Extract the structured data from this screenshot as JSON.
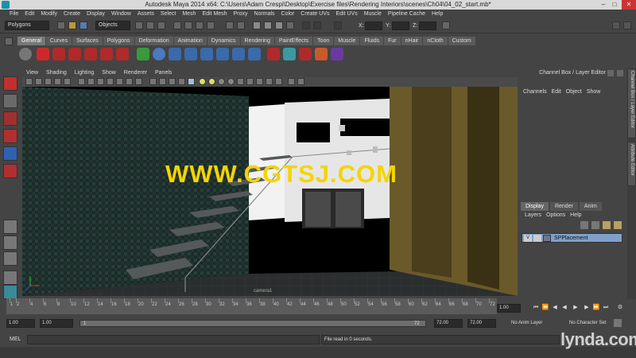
{
  "window": {
    "title": "Autodesk Maya 2014 x64: C:\\Users\\Adam Crespi\\Desktop\\Exercise files\\Rendering Interiors\\scenes\\Ch04\\04_02_start.mb*",
    "minimize": "–",
    "maximize": "□",
    "close": "✕"
  },
  "menubar": [
    "File",
    "Edit",
    "Modify",
    "Create",
    "Display",
    "Window",
    "Assets",
    "Select",
    "Mesh",
    "Edit Mesh",
    "Proxy",
    "Normals",
    "Color",
    "Create UVs",
    "Edit UVs",
    "Muscle",
    "Pipeline Cache",
    "Help"
  ],
  "statusline": {
    "mode": "Polygons",
    "selection_mode": "Objects",
    "x_label": "X:",
    "y_label": "Y:",
    "z_label": "Z:"
  },
  "shelf": {
    "tabs": [
      "General",
      "Curves",
      "Surfaces",
      "Polygons",
      "Deformation",
      "Animation",
      "Dynamics",
      "Rendering",
      "PaintEffects",
      "Toon",
      "Muscle",
      "Fluids",
      "Fur",
      "nHair",
      "nCloth",
      "Custom"
    ],
    "active": "General"
  },
  "viewport": {
    "menu": [
      "View",
      "Shading",
      "Lighting",
      "Show",
      "Renderer",
      "Panels"
    ],
    "camera": "camera1",
    "watermark": "WWW.CGTSJ.COM"
  },
  "channelbox": {
    "title": "Channel Box / Layer Editor",
    "menu": [
      "Channels",
      "Edit",
      "Object",
      "Show"
    ],
    "side_tabs": [
      "Channel Box / Layer Editor",
      "Attribute Editor"
    ]
  },
  "layer_editor": {
    "tabs": [
      "Display",
      "Render",
      "Anim"
    ],
    "active": "Display",
    "menu": [
      "Layers",
      "Options",
      "Help"
    ],
    "layers": [
      {
        "visible": "V",
        "name": "SPPlacement"
      }
    ]
  },
  "timeslider": {
    "ticks": [
      "1",
      "2",
      "4",
      "6",
      "8",
      "10",
      "12",
      "14",
      "16",
      "18",
      "20",
      "22",
      "24",
      "26",
      "28",
      "30",
      "32",
      "34",
      "36",
      "38",
      "40",
      "42",
      "44",
      "46",
      "48",
      "50",
      "52",
      "54",
      "56",
      "58",
      "60",
      "62",
      "64",
      "66",
      "68",
      "70",
      "72"
    ],
    "current_time": "1.00"
  },
  "rangeslider": {
    "start": "1.00",
    "anim_start": "1.00",
    "range_start": "1",
    "range_end": "72",
    "anim_end": "72.00",
    "end": "72.00",
    "anim_layer": "No Anim Layer",
    "character_set": "No Character Set"
  },
  "commandline": {
    "label": "MEL",
    "result": "File read in 0 seconds."
  },
  "branding": "lynda.com"
}
